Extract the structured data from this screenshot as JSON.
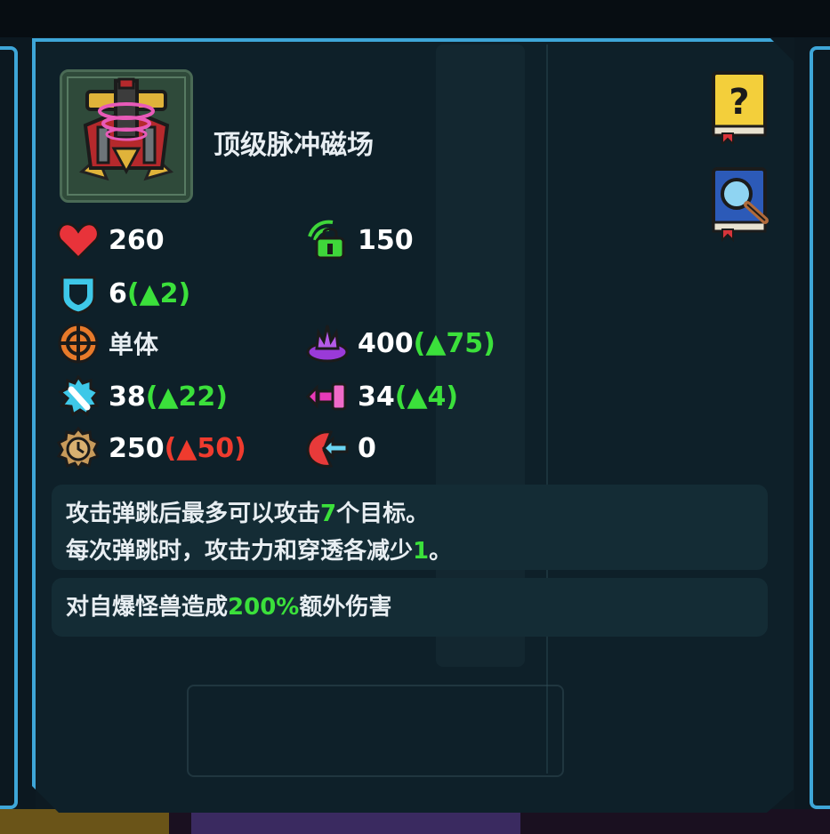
{
  "unit": {
    "name": "顶级脉冲磁场"
  },
  "stats": {
    "hp": {
      "value": "260",
      "icon": "heart-icon",
      "color": "#e8333a"
    },
    "range": {
      "value": "150",
      "icon": "green-range-icon",
      "color": "#3fd63a"
    },
    "armor": {
      "value": "6",
      "bonus": "(▲2)",
      "icon": "shield-icon",
      "color": "#3ec8e8"
    },
    "target": {
      "value": "单体",
      "icon": "crosshair-icon",
      "color": "#e87a2a"
    },
    "explosion": {
      "value": "400",
      "bonus": "(▲75)",
      "icon": "purple-blast-icon",
      "color": "#9a3ad8"
    },
    "attack": {
      "value": "38",
      "bonus": "(▲22)",
      "icon": "attack-gear-icon",
      "color": "#3ec8e8"
    },
    "pierce": {
      "value": "34",
      "bonus": "(▲4)",
      "icon": "pink-pierce-icon",
      "color": "#e83ab8"
    },
    "cooldown": {
      "value": "250",
      "bonus": "(▲50)",
      "icon": "clock-icon",
      "color": "#c89a5a"
    },
    "knockback": {
      "value": "0",
      "icon": "red-knockback-icon",
      "color": "#e83a3a"
    }
  },
  "descriptions": {
    "line1_a": "攻击弹跳后最多可以攻击",
    "line1_num": "7",
    "line1_b": "个目标。",
    "line2_a": "每次弹跳时，攻击力和穿透各减少",
    "line2_num": "1",
    "line2_b": "。",
    "line3_a": "对自爆怪兽造成",
    "line3_num": "200%",
    "line3_b": "额外伤害"
  },
  "buttons": {
    "help_icon": "question-book-icon",
    "search_icon": "magnifier-book-icon"
  },
  "colors": {
    "frame": "#3ea6d8",
    "panel": "#0e2029",
    "increase": "#3be03b",
    "decrease": "#ef3b2e"
  }
}
